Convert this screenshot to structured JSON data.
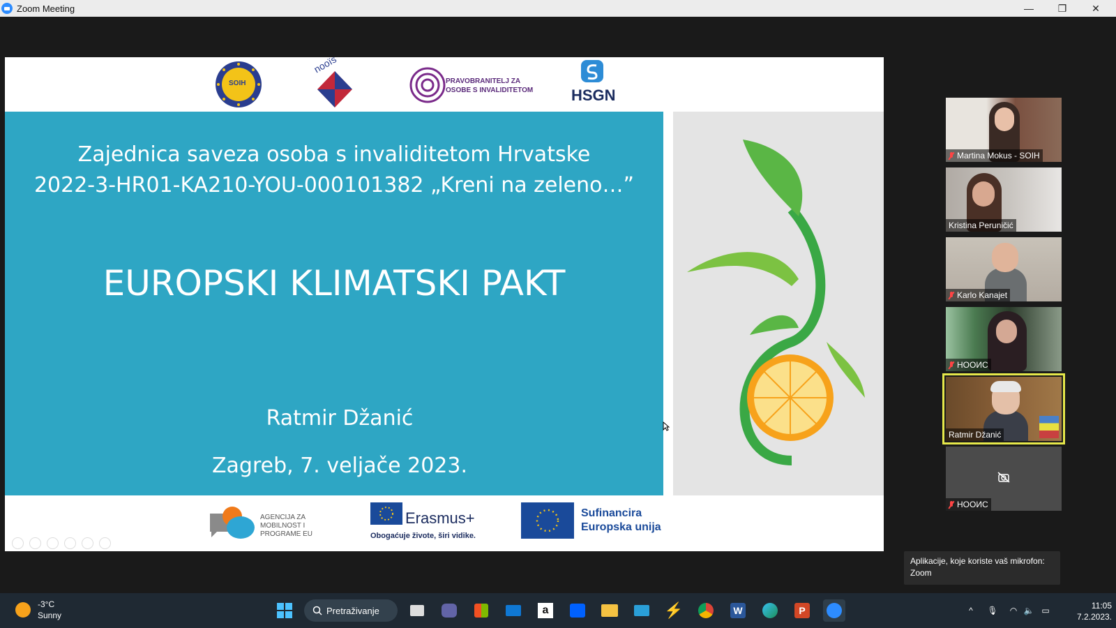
{
  "window": {
    "title": "Zoom Meeting",
    "minimize": "—",
    "restore": "❐",
    "close": "✕"
  },
  "slide": {
    "org_line1": "Zajednica saveza osoba s invaliditetom Hrvatske",
    "org_line2": "2022-3-HR01-KA210-YOU-000101382 „Kreni na zeleno…”",
    "title": "EUROPSKI KLIMATSKI PAKT",
    "author": "Ratmir Džanić",
    "place_date": "Zagreb, 7. veljače 2023.",
    "logo_soih": "SOIH",
    "logo_noois": "nooïs",
    "logo_pravobranitelj_1": "PRAVOBRANITELJ ZA",
    "logo_pravobranitelj_2": "OSOBE S INVALIDITETOM",
    "logo_hsgn": "HSGN",
    "agency_1": "AGENCIJA ZA",
    "agency_2": "MOBILNOST I",
    "agency_3": "PROGRAME EU",
    "erasmus": "Erasmus+",
    "erasmus_sub": "Obogaćuje živote, širi vidike.",
    "eu_1": "Sufinancira",
    "eu_2": "Europska unija"
  },
  "participants": [
    {
      "name": "Martina Mokus - SOIH",
      "muted": true,
      "bg": "#8a7565"
    },
    {
      "name": "Kristina Peruničić",
      "muted": false,
      "bg": "#9a9a9a"
    },
    {
      "name": "Karlo Kanajet",
      "muted": true,
      "bg": "#a09a90"
    },
    {
      "name": "НООИС",
      "muted": true,
      "bg": "#4a6a4a"
    },
    {
      "name": "Ratmir Džanić",
      "muted": false,
      "bg": "#7a5a3a",
      "active": true
    },
    {
      "name": "НООИС",
      "muted": true,
      "bg": "#4a4a4a",
      "camera_off": true
    }
  ],
  "tooltip": {
    "line1": "Aplikacije, koje koriste vaš mikrofon:",
    "line2": "Zoom"
  },
  "taskbar": {
    "temperature": "-3°C",
    "weather": "Sunny",
    "search": "Pretraživanje",
    "time": "11:05",
    "date": "7.2.2023."
  },
  "colors": {
    "slide_blue": "#2ea6c4",
    "zoom_blue": "#2d8cff",
    "active_speaker": "#e6e84a"
  }
}
